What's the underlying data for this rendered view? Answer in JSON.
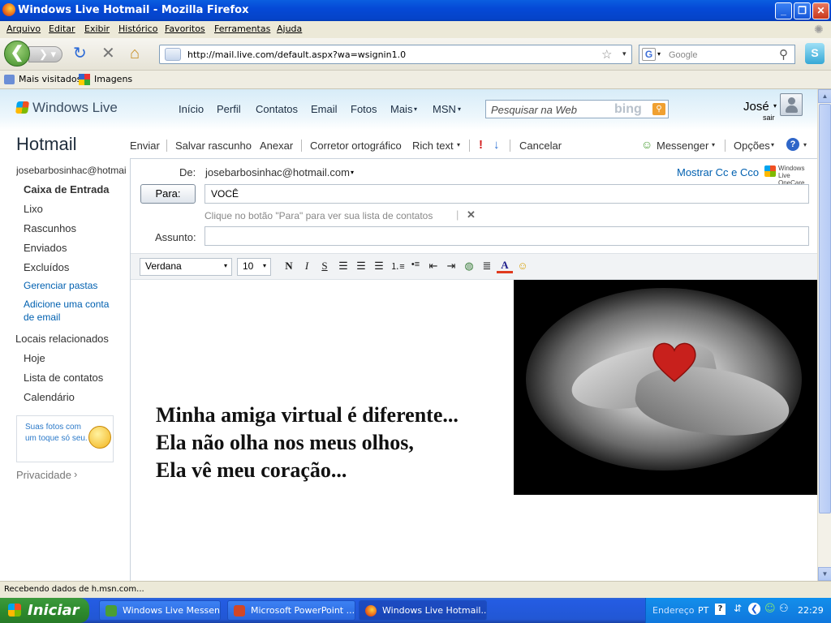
{
  "window": {
    "title": "Windows Live Hotmail - Mozilla Firefox"
  },
  "menubar": [
    "Arquivo",
    "Editar",
    "Exibir",
    "Histórico",
    "Favoritos",
    "Ferramentas",
    "Ajuda"
  ],
  "navbar": {
    "url": "http://mail.live.com/default.aspx?wa=wsignin1.0",
    "search_placeholder": "Google"
  },
  "bookmarks": [
    "Mais visitados",
    "Imagens"
  ],
  "wl": {
    "logo": "Windows Live",
    "nav": [
      "Início",
      "Perfil",
      "Contatos",
      "Email",
      "Fotos",
      "Mais",
      "MSN"
    ],
    "search_placeholder": "Pesquisar na Web",
    "bing": "bing",
    "user": "José",
    "signout": "sair"
  },
  "sidebar": {
    "title": "Hotmail",
    "account": "josebarbosinhac@hotmail.com",
    "folders": [
      "Caixa de Entrada",
      "Lixo",
      "Rascunhos",
      "Enviados",
      "Excluídos"
    ],
    "manage": "Gerenciar pastas",
    "add_account": "Adicione uma conta de email",
    "related_title": "Locais relacionados",
    "related": [
      "Hoje",
      "Lista de contatos",
      "Calendário"
    ],
    "promo": "Suas fotos com um toque só seu.",
    "privacy": "Privacidade"
  },
  "toolbar": {
    "send": "Enviar",
    "save_draft": "Salvar rascunho",
    "attach": "Anexar",
    "spellcheck": "Corretor ortográfico",
    "richtext": "Rich text",
    "cancel": "Cancelar",
    "messenger": "Messenger",
    "options": "Opções"
  },
  "compose": {
    "from_label": "De:",
    "from_value": "josebarbosinhac@hotmail.com",
    "show_cc": "Mostrar Cc e Cco",
    "onecare": "Windows Live OneCare",
    "to_button": "Para:",
    "to_value": "VOCÊ",
    "hint": "Clique no botão \"Para\" para ver sua lista de contatos",
    "subject_label": "Assunto:",
    "subject_value": "",
    "font": "Verdana",
    "size": "10",
    "poem": [
      "Minha amiga virtual é diferente...",
      "Ela não olha nos meus olhos,",
      "Ela vê meu coração..."
    ]
  },
  "status": "Recebendo dados de h.msn.com...",
  "taskbar": {
    "start": "Iniciar",
    "tasks": [
      "Windows Live Messen...",
      "Microsoft PowerPoint ...",
      "Windows Live Hotmail..."
    ],
    "tray_label": "Endereço",
    "lang": "PT",
    "clock": "22:29"
  }
}
